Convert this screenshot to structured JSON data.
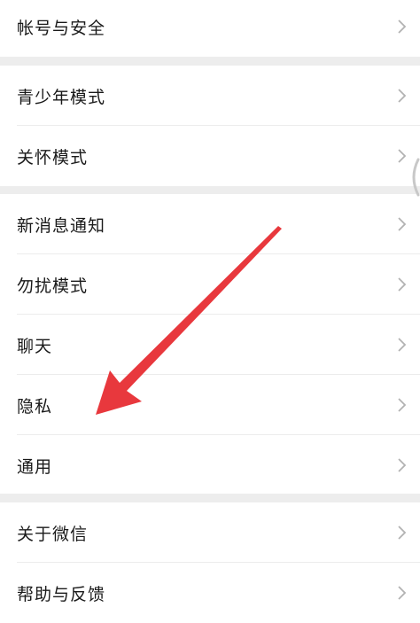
{
  "settings": {
    "group1": {
      "items": [
        {
          "label": "帐号与安全"
        }
      ]
    },
    "group2": {
      "items": [
        {
          "label": "青少年模式"
        },
        {
          "label": "关怀模式"
        }
      ]
    },
    "group3": {
      "items": [
        {
          "label": "新消息通知"
        },
        {
          "label": "勿扰模式"
        },
        {
          "label": "聊天"
        },
        {
          "label": "隐私"
        },
        {
          "label": "通用"
        }
      ]
    },
    "group4": {
      "items": [
        {
          "label": "关于微信"
        },
        {
          "label": "帮助与反馈"
        }
      ]
    }
  },
  "annotation": {
    "arrow_color": "#e8383d"
  },
  "colors": {
    "background": "#ededed",
    "row_background": "#ffffff",
    "text": "#1a1a1a",
    "chevron": "#b2b2b2"
  },
  "icons": {
    "row_chevron": "chevron-right-icon"
  }
}
